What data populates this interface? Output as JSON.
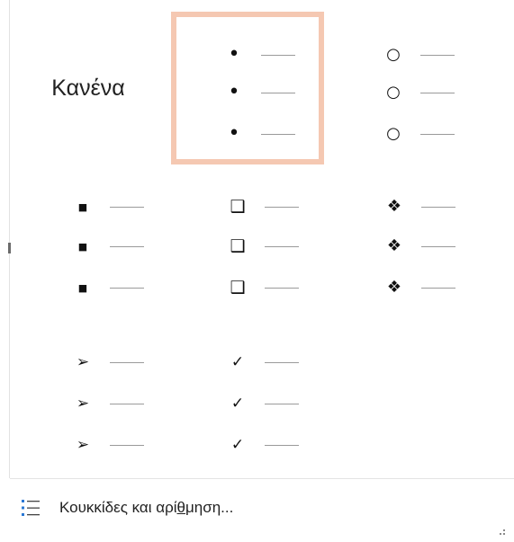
{
  "none_label": "Κανένα",
  "footer": {
    "label_before": "Κουκκίδες και αρί",
    "label_accel": "θ",
    "label_after": "μηση..."
  },
  "bullet_library": [
    {
      "name": "none",
      "glyph": "",
      "selected": false
    },
    {
      "name": "small-dot",
      "glyph": "•",
      "selected": true
    },
    {
      "name": "hollow-circle",
      "glyph": "○",
      "selected": false
    },
    {
      "name": "square",
      "glyph": "■",
      "selected": false
    },
    {
      "name": "hollow-square",
      "glyph": "❑",
      "selected": false
    },
    {
      "name": "four-diamonds",
      "glyph": "❖",
      "selected": false
    },
    {
      "name": "arrowhead",
      "glyph": "➢",
      "selected": false
    },
    {
      "name": "checkmark",
      "glyph": "✓",
      "selected": false
    }
  ],
  "colors": {
    "selection_border": "#f5c8b2",
    "footer_icon": "#2b78d4"
  }
}
